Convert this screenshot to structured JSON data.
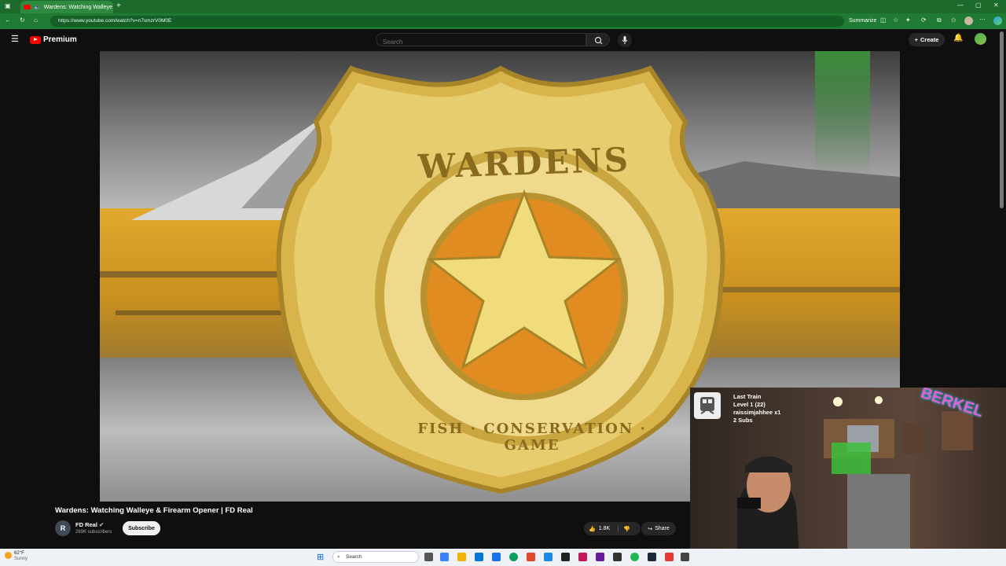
{
  "browser": {
    "tab_title": "Wardens: Watching Walleye",
    "url": "https://www.youtube.com/watch?v=n7smzrV0M0E",
    "summarize_label": "Summarize"
  },
  "youtube": {
    "logo_text": "Premium",
    "search_placeholder": "Search",
    "create_label": "Create"
  },
  "video": {
    "badge_top_text": "WARDENS",
    "badge_ring_text": "FISH · CONSERVATION · GAME",
    "title": "Wardens: Watching Walleye & Firearm Opener | FD Real",
    "channel": {
      "name": "FD Real",
      "avatar_text": "R",
      "subscribers": "269K subscribers",
      "subscribe_label": "Subscribe"
    },
    "likes": "1.8K",
    "share_label": "Share"
  },
  "stream_overlay": {
    "line1": "Last Train",
    "line2": "Level 1  (22)",
    "line3": "raissimjahhee x1",
    "line4": "2 Subs",
    "sign_text": "BERKEL"
  },
  "taskbar": {
    "temperature": "62°F",
    "condition": "Sunny",
    "search_placeholder": "Search"
  },
  "colors": {
    "browser_green": "#1f7a33",
    "youtube_red": "#ff0000",
    "badge_gold": "#e3c35a"
  }
}
